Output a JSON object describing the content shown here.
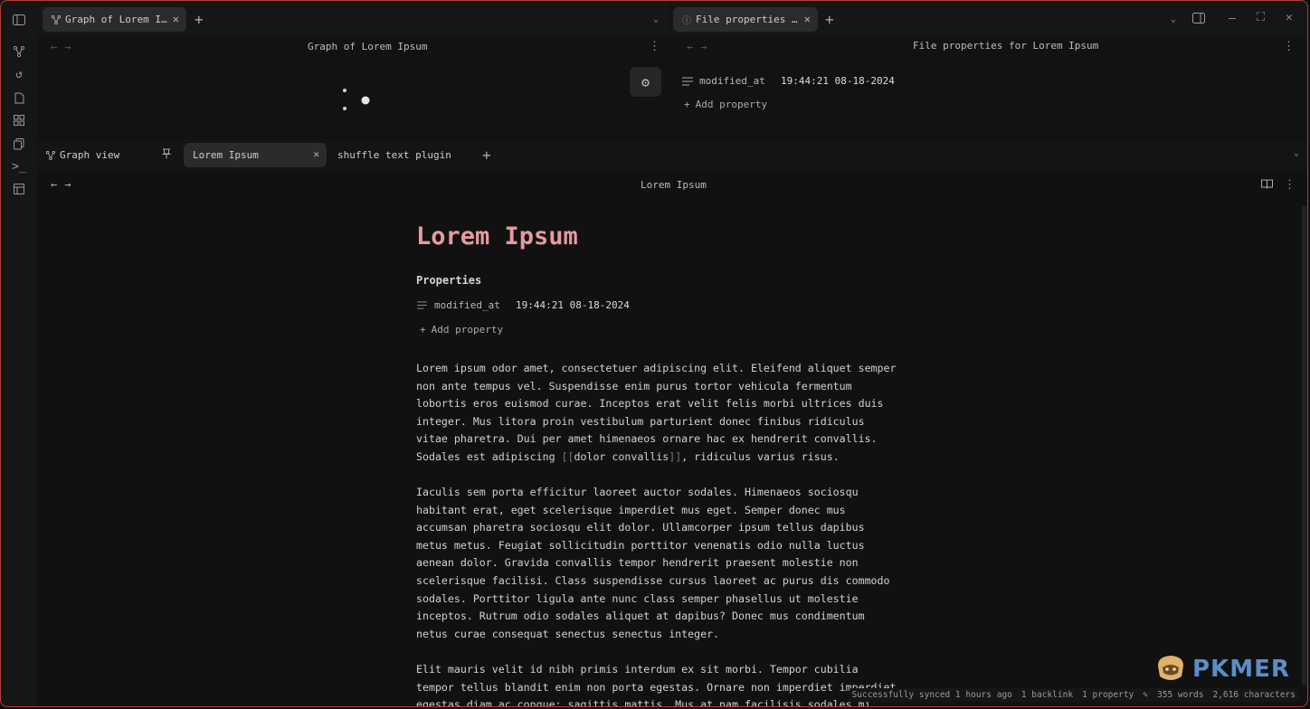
{
  "ribbon": {
    "icons": [
      "sidebar-toggle-icon",
      "graph-icon",
      "history-icon",
      "file-icon",
      "grid-icon",
      "copy-icon",
      "terminal-icon",
      "layout-icon"
    ]
  },
  "left_tabbar": {
    "tab_label": "Graph of Lorem I…"
  },
  "right_tabbar": {
    "tab_label": "File properties …"
  },
  "graph_pane": {
    "title": "Graph of Lorem Ipsum"
  },
  "properties_pane": {
    "title": "File properties for Lorem Ipsum",
    "property_key": "modified_at",
    "property_value": "19:44:21 08-18-2024",
    "add_label": "Add property"
  },
  "lower_tabs": {
    "tab1": "Graph view",
    "tab2": "Lorem Ipsum",
    "tab3": "shuffle text plugin"
  },
  "editor": {
    "header_title": "Lorem Ipsum",
    "doc_title": "Lorem Ipsum",
    "properties_heading": "Properties",
    "property_key": "modified_at",
    "property_value": "19:44:21 08-18-2024",
    "add_label": "Add property",
    "para1_a": "Lorem ipsum odor amet, consectetuer adipiscing elit. Eleifend aliquet semper\nnon ante tempus vel. Suspendisse enim purus tortor vehicula fermentum\nlobortis eros euismod curae. Inceptos erat velit felis morbi ultrices duis\ninteger. Mus litora proin vestibulum parturient donec finibus ridiculus\nvitae pharetra. Dui per amet himenaeos ornare hac ex hendrerit convallis.\nSodales est adipiscing ",
    "para1_link_open": "[[",
    "para1_link": "dolor convallis",
    "para1_link_close": "]]",
    "para1_b": ", ridiculus varius risus.",
    "para2": "Iaculis sem porta efficitur laoreet auctor sodales. Himenaeos sociosqu\nhabitant erat, eget scelerisque imperdiet mus eget. Semper donec mus\naccumsan pharetra sociosqu elit dolor. Ullamcorper ipsum tellus dapibus\nmetus metus. Feugiat sollicitudin porttitor venenatis odio nulla luctus\naenean dolor. Gravida convallis tempor hendrerit praesent molestie non\nscelerisque facilisi. Class suspendisse cursus laoreet ac purus dis commodo\nsodales. Porttitor ligula ante nunc class semper phasellus ut molestie\ninceptos. Rutrum odio sodales aliquet at dapibus? Donec mus condimentum\nnetus curae consequat senectus senectus integer.",
    "para3": "Elit mauris velit id nibh primis interdum ex sit morbi. Tempor cubilia\ntempor tellus blandit enim non porta egestas. Ornare non imperdiet imperdiet\negestas diam ac congue; sagittis mattis. Mus at nam facilisis sodales mi."
  },
  "status_bar": {
    "sync": "Successfully synced 1 hours ago",
    "backlinks": "1 backlink",
    "properties": "1 property",
    "words": "355 words",
    "characters": "2,616 characters"
  },
  "watermark": {
    "text": "PKMER"
  },
  "colors": {
    "title_accent": "#e59aa0",
    "frame_border": "#b83a3a",
    "watermark_blue": "#5b8ec6"
  }
}
